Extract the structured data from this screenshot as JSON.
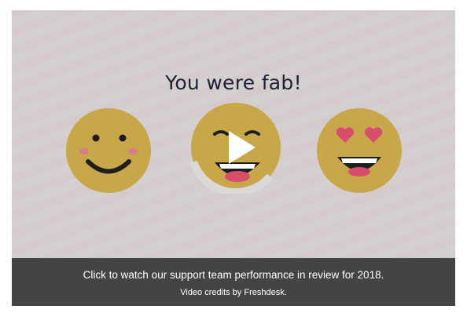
{
  "video": {
    "title": "You were fab!",
    "caption": "Click to watch our support team performance in review for 2018.",
    "credits": "Video credits by Freshdesk.",
    "play_icon": "play-icon"
  },
  "colors": {
    "background": "#d4d0d0",
    "emoji_face": "#c8a64a",
    "cheek": "#d67c8a",
    "heart": "#d84d6b",
    "caption_bar": "#444444",
    "title_text": "#1d2236"
  },
  "emojis": [
    "smiling-face-icon",
    "laughing-face-icon",
    "heart-eyes-face-icon"
  ]
}
